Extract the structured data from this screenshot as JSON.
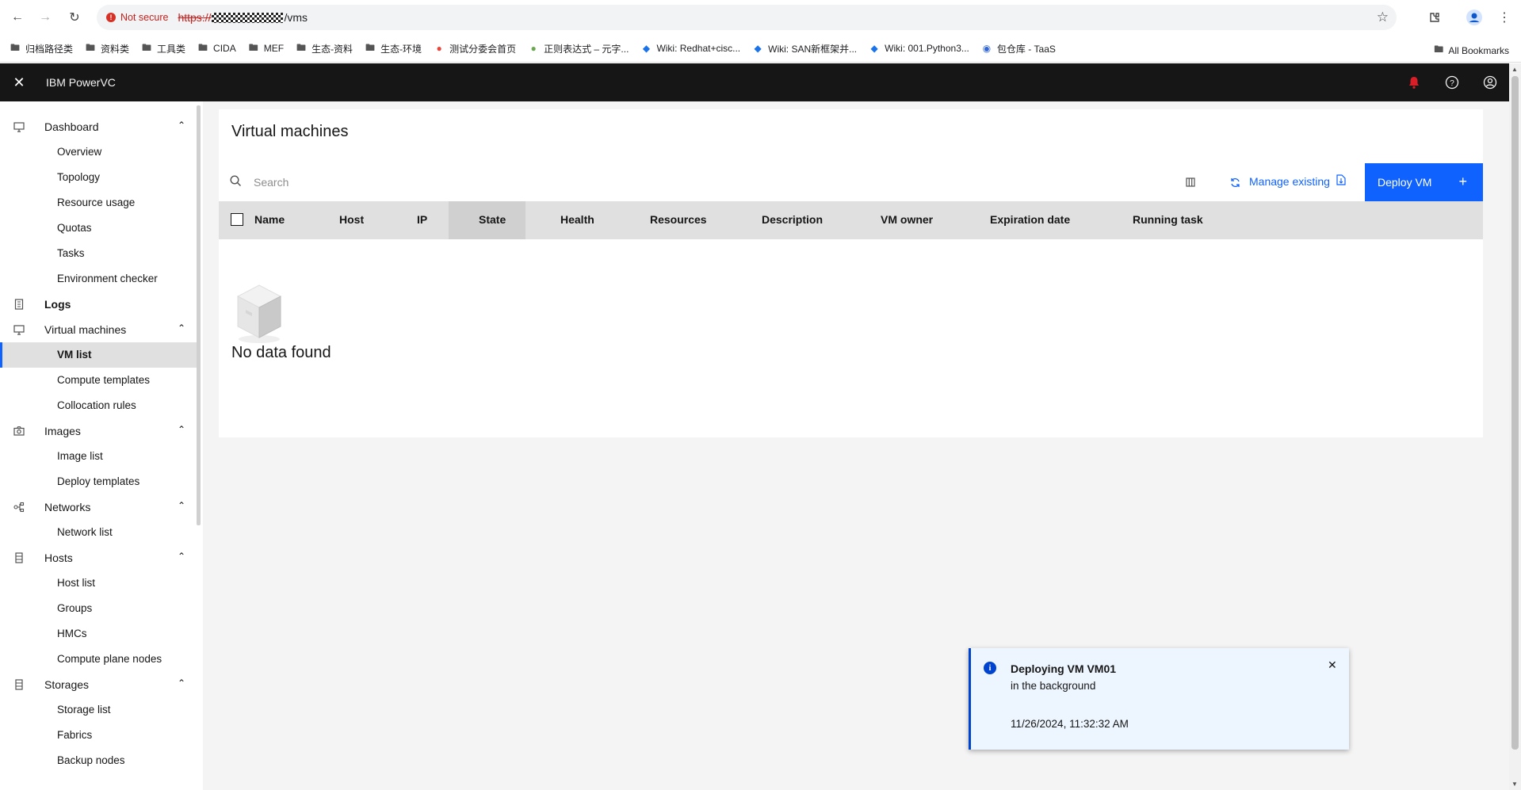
{
  "browser": {
    "not_secure": "Not secure",
    "url_scheme": "https://",
    "url_path": "/vms",
    "bookmarks": [
      {
        "label": "归档路径类",
        "icon": "folder-icon"
      },
      {
        "label": "资料类",
        "icon": "folder-icon"
      },
      {
        "label": "工具类",
        "icon": "folder-icon"
      },
      {
        "label": "CIDA",
        "icon": "folder-icon"
      },
      {
        "label": "MEF",
        "icon": "folder-icon"
      },
      {
        "label": "生态-资料",
        "icon": "folder-icon"
      },
      {
        "label": "生态-环境",
        "icon": "folder-icon"
      },
      {
        "label": "测试分委会首页",
        "icon": "site-icon"
      },
      {
        "label": "正则表达式 – 元字...",
        "icon": "site-icon"
      },
      {
        "label": "Wiki: Redhat+cisc...",
        "icon": "wiki-icon"
      },
      {
        "label": "Wiki: SAN新框架并...",
        "icon": "wiki-icon"
      },
      {
        "label": "Wiki: 001.Python3...",
        "icon": "wiki-icon"
      },
      {
        "label": "包仓库 - TaaS",
        "icon": "site-icon"
      }
    ],
    "all_bookmarks": "All Bookmarks"
  },
  "app": {
    "title": "IBM PowerVC",
    "notification_color": "#da1e28"
  },
  "sidebar": {
    "groups": [
      {
        "label": "Dashboard",
        "icon": "monitor-icon",
        "items": [
          "Overview",
          "Topology",
          "Resource usage",
          "Quotas",
          "Tasks",
          "Environment checker"
        ]
      },
      {
        "label": "Logs",
        "icon": "document-icon",
        "items": []
      },
      {
        "label": "Virtual machines",
        "icon": "monitor-icon",
        "items": [
          "VM list",
          "Compute templates",
          "Collocation rules"
        ]
      },
      {
        "label": "Images",
        "icon": "camera-icon",
        "items": [
          "Image list",
          "Deploy templates"
        ]
      },
      {
        "label": "Networks",
        "icon": "network-icon",
        "items": [
          "Network list"
        ]
      },
      {
        "label": "Hosts",
        "icon": "server-icon",
        "items": [
          "Host list",
          "Groups",
          "HMCs",
          "Compute plane nodes"
        ]
      },
      {
        "label": "Storages",
        "icon": "storage-icon",
        "items": [
          "Storage list",
          "Fabrics",
          "Backup nodes"
        ]
      }
    ],
    "active_item": "VM list"
  },
  "main": {
    "title": "Virtual machines",
    "search_placeholder": "Search",
    "manage_existing": "Manage existing",
    "deploy_vm": "Deploy VM",
    "columns": [
      "Name",
      "Host",
      "IP",
      "State",
      "Health",
      "Resources",
      "Description",
      "VM owner",
      "Expiration date",
      "Running task"
    ],
    "empty_text": "No data found"
  },
  "toast": {
    "title": "Deploying VM VM01",
    "subtitle": "in the background",
    "timestamp": "11/26/2024, 11:32:32 AM",
    "accent": "#0043ce"
  },
  "colors": {
    "primary": "#0f62fe",
    "header_bg": "#161616"
  }
}
